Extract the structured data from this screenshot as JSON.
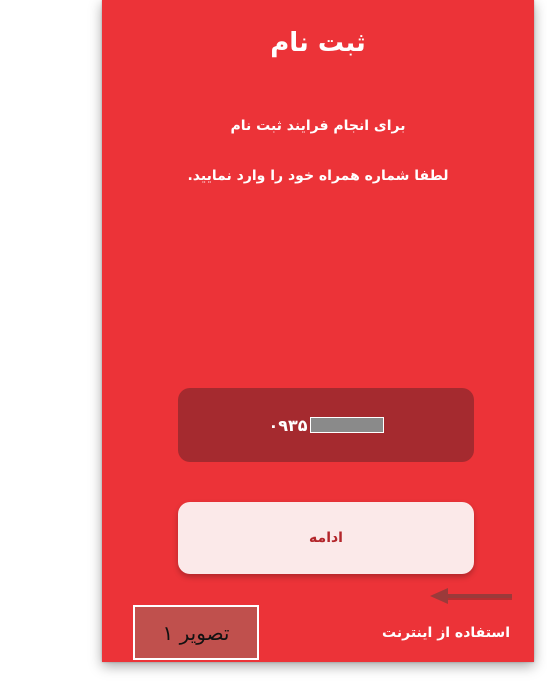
{
  "screen": {
    "title": "ثبت نام",
    "instruction_line1": "برای انجام فرایند ثبت نام",
    "instruction_line2": "لطفا شماره همراه خود را وارد نمایید."
  },
  "phone_input": {
    "visible_prefix": "۰۹۳۵",
    "redacted": true
  },
  "continue_button": {
    "label": "ادامه"
  },
  "internet_option": {
    "label": "استفاده از اینترنت",
    "checked": true
  },
  "caption": {
    "text": "تصویر ۱"
  },
  "colors": {
    "background_red": "#ec3338",
    "input_dark_red": "#a52a2f",
    "button_light": "#fbe9e9",
    "caption_box": "#c0504d",
    "arrow": "#9b3a3a"
  }
}
